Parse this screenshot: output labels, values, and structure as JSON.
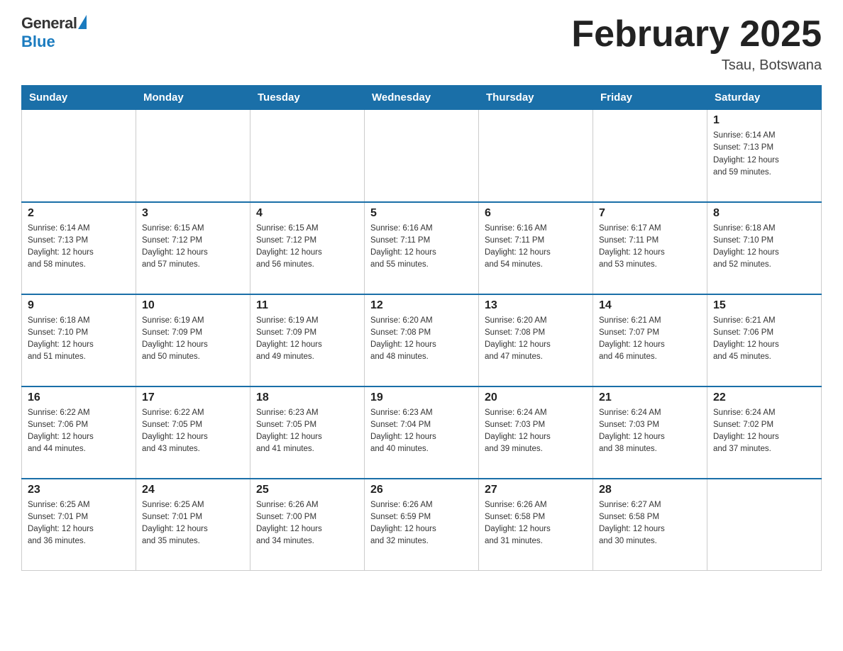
{
  "header": {
    "logo_general": "General",
    "logo_blue": "Blue",
    "month_title": "February 2025",
    "location": "Tsau, Botswana"
  },
  "days_of_week": [
    "Sunday",
    "Monday",
    "Tuesday",
    "Wednesday",
    "Thursday",
    "Friday",
    "Saturday"
  ],
  "weeks": [
    [
      {
        "day": "",
        "info": ""
      },
      {
        "day": "",
        "info": ""
      },
      {
        "day": "",
        "info": ""
      },
      {
        "day": "",
        "info": ""
      },
      {
        "day": "",
        "info": ""
      },
      {
        "day": "",
        "info": ""
      },
      {
        "day": "1",
        "info": "Sunrise: 6:14 AM\nSunset: 7:13 PM\nDaylight: 12 hours\nand 59 minutes."
      }
    ],
    [
      {
        "day": "2",
        "info": "Sunrise: 6:14 AM\nSunset: 7:13 PM\nDaylight: 12 hours\nand 58 minutes."
      },
      {
        "day": "3",
        "info": "Sunrise: 6:15 AM\nSunset: 7:12 PM\nDaylight: 12 hours\nand 57 minutes."
      },
      {
        "day": "4",
        "info": "Sunrise: 6:15 AM\nSunset: 7:12 PM\nDaylight: 12 hours\nand 56 minutes."
      },
      {
        "day": "5",
        "info": "Sunrise: 6:16 AM\nSunset: 7:11 PM\nDaylight: 12 hours\nand 55 minutes."
      },
      {
        "day": "6",
        "info": "Sunrise: 6:16 AM\nSunset: 7:11 PM\nDaylight: 12 hours\nand 54 minutes."
      },
      {
        "day": "7",
        "info": "Sunrise: 6:17 AM\nSunset: 7:11 PM\nDaylight: 12 hours\nand 53 minutes."
      },
      {
        "day": "8",
        "info": "Sunrise: 6:18 AM\nSunset: 7:10 PM\nDaylight: 12 hours\nand 52 minutes."
      }
    ],
    [
      {
        "day": "9",
        "info": "Sunrise: 6:18 AM\nSunset: 7:10 PM\nDaylight: 12 hours\nand 51 minutes."
      },
      {
        "day": "10",
        "info": "Sunrise: 6:19 AM\nSunset: 7:09 PM\nDaylight: 12 hours\nand 50 minutes."
      },
      {
        "day": "11",
        "info": "Sunrise: 6:19 AM\nSunset: 7:09 PM\nDaylight: 12 hours\nand 49 minutes."
      },
      {
        "day": "12",
        "info": "Sunrise: 6:20 AM\nSunset: 7:08 PM\nDaylight: 12 hours\nand 48 minutes."
      },
      {
        "day": "13",
        "info": "Sunrise: 6:20 AM\nSunset: 7:08 PM\nDaylight: 12 hours\nand 47 minutes."
      },
      {
        "day": "14",
        "info": "Sunrise: 6:21 AM\nSunset: 7:07 PM\nDaylight: 12 hours\nand 46 minutes."
      },
      {
        "day": "15",
        "info": "Sunrise: 6:21 AM\nSunset: 7:06 PM\nDaylight: 12 hours\nand 45 minutes."
      }
    ],
    [
      {
        "day": "16",
        "info": "Sunrise: 6:22 AM\nSunset: 7:06 PM\nDaylight: 12 hours\nand 44 minutes."
      },
      {
        "day": "17",
        "info": "Sunrise: 6:22 AM\nSunset: 7:05 PM\nDaylight: 12 hours\nand 43 minutes."
      },
      {
        "day": "18",
        "info": "Sunrise: 6:23 AM\nSunset: 7:05 PM\nDaylight: 12 hours\nand 41 minutes."
      },
      {
        "day": "19",
        "info": "Sunrise: 6:23 AM\nSunset: 7:04 PM\nDaylight: 12 hours\nand 40 minutes."
      },
      {
        "day": "20",
        "info": "Sunrise: 6:24 AM\nSunset: 7:03 PM\nDaylight: 12 hours\nand 39 minutes."
      },
      {
        "day": "21",
        "info": "Sunrise: 6:24 AM\nSunset: 7:03 PM\nDaylight: 12 hours\nand 38 minutes."
      },
      {
        "day": "22",
        "info": "Sunrise: 6:24 AM\nSunset: 7:02 PM\nDaylight: 12 hours\nand 37 minutes."
      }
    ],
    [
      {
        "day": "23",
        "info": "Sunrise: 6:25 AM\nSunset: 7:01 PM\nDaylight: 12 hours\nand 36 minutes."
      },
      {
        "day": "24",
        "info": "Sunrise: 6:25 AM\nSunset: 7:01 PM\nDaylight: 12 hours\nand 35 minutes."
      },
      {
        "day": "25",
        "info": "Sunrise: 6:26 AM\nSunset: 7:00 PM\nDaylight: 12 hours\nand 34 minutes."
      },
      {
        "day": "26",
        "info": "Sunrise: 6:26 AM\nSunset: 6:59 PM\nDaylight: 12 hours\nand 32 minutes."
      },
      {
        "day": "27",
        "info": "Sunrise: 6:26 AM\nSunset: 6:58 PM\nDaylight: 12 hours\nand 31 minutes."
      },
      {
        "day": "28",
        "info": "Sunrise: 6:27 AM\nSunset: 6:58 PM\nDaylight: 12 hours\nand 30 minutes."
      },
      {
        "day": "",
        "info": ""
      }
    ]
  ]
}
